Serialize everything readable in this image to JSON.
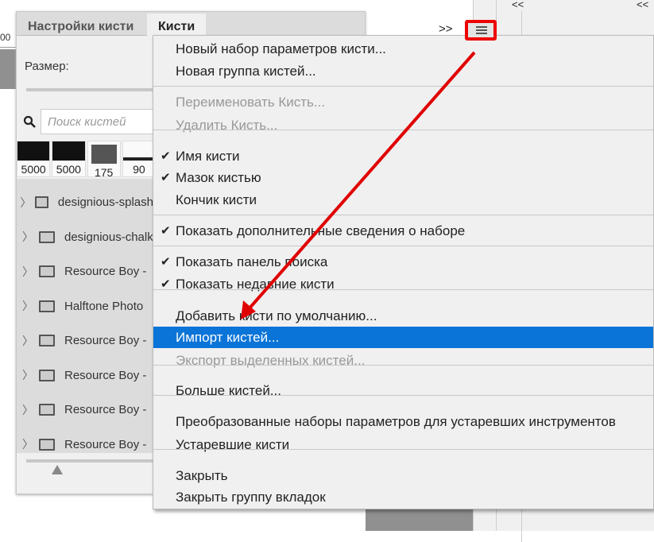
{
  "ruler": {
    "label": "00"
  },
  "panel": {
    "tabs": [
      {
        "label": "Настройки кисти"
      },
      {
        "label": "Кисти"
      }
    ],
    "size_label": "Размер:",
    "search_placeholder": "Поиск кистей",
    "thumbs": [
      "5000",
      "5000",
      "175",
      "90"
    ],
    "groups": [
      "designious-splash",
      "designious-chalk",
      "Resource Boy -",
      "Halftone Photo",
      "Resource Boy -",
      "Resource Boy -",
      "Resource Boy -",
      "Resource Boy -"
    ]
  },
  "toolbar": {
    "more": ">>",
    "menu_icon": "hamburger-icon",
    "collapse": "<<"
  },
  "menu": {
    "items": [
      {
        "label": "Новый набор параметров кисти...",
        "state": "normal"
      },
      {
        "label": "Новая группа кистей...",
        "state": "normal"
      },
      {
        "label": "Переименовать Кисть...",
        "state": "disabled"
      },
      {
        "label": "Удалить Кисть...",
        "state": "disabled"
      },
      {
        "label": "Имя кисти",
        "state": "checked"
      },
      {
        "label": "Мазок кистью",
        "state": "checked"
      },
      {
        "label": "Кончик кисти",
        "state": "normal"
      },
      {
        "label": "Показать дополнительные сведения о наборе",
        "state": "checked"
      },
      {
        "label": "Показать панель поиска",
        "state": "checked"
      },
      {
        "label": "Показать недавние кисти",
        "state": "checked"
      },
      {
        "label": "Добавить кисти по умолчанию...",
        "state": "normal"
      },
      {
        "label": "Импорт кистей...",
        "state": "highlighted"
      },
      {
        "label": "Экспорт выделенных кистей...",
        "state": "disabled"
      },
      {
        "label": "Больше кистей...",
        "state": "normal"
      },
      {
        "label": "Преобразованные наборы параметров для устаревших инструментов",
        "state": "normal"
      },
      {
        "label": "Устаревшие кисти",
        "state": "normal"
      },
      {
        "label": "Закрыть",
        "state": "normal"
      },
      {
        "label": "Закрыть группу вкладок",
        "state": "normal"
      }
    ],
    "check_mark": "✔"
  },
  "colors": {
    "highlight": "#0a74d8",
    "annotation": "#e00000"
  }
}
